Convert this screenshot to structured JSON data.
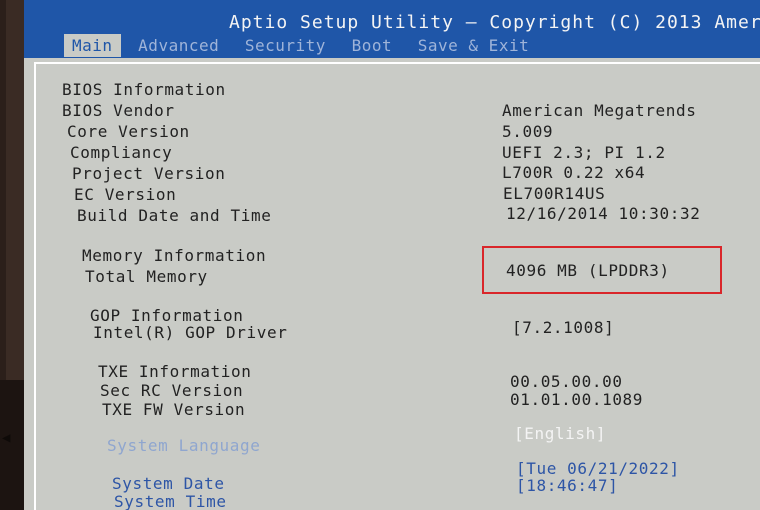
{
  "header": {
    "title": "Aptio Setup Utility – Copyright (C) 2013 Amer",
    "tabs": [
      "Main",
      "Advanced",
      "Security",
      "Boot",
      "Save & Exit"
    ],
    "active_tab": "Main"
  },
  "bios_info": {
    "section_label": "BIOS Information",
    "rows": [
      {
        "label": "BIOS Vendor",
        "value": "American Megatrends"
      },
      {
        "label": "Core Version",
        "value": "5.009"
      },
      {
        "label": "Compliancy",
        "value": "UEFI 2.3; PI 1.2"
      },
      {
        "label": "Project Version",
        "value": "L700R 0.22 x64"
      },
      {
        "label": "EC Version",
        "value": "EL700R14US"
      },
      {
        "label": "Build Date and Time",
        "value": "12/16/2014 10:30:32"
      }
    ]
  },
  "memory_info": {
    "section_label": "Memory Information",
    "total_label": "Total Memory",
    "total_value": "4096 MB (LPDDR3)"
  },
  "gop_info": {
    "section_label": "GOP Information",
    "driver_label": "Intel(R) GOP Driver",
    "driver_value": "[7.2.1008]"
  },
  "txe_info": {
    "section_label": "TXE Information",
    "rows": [
      {
        "label": "Sec RC Version",
        "value": "00.05.00.00"
      },
      {
        "label": "TXE FW Version",
        "value": "01.01.00.1089"
      }
    ]
  },
  "system": {
    "language_label": "System Language",
    "language_value": "[English]",
    "date_label": "System Date",
    "date_value": "[Tue 06/21/2022]",
    "time_label": "System Time",
    "time_value": "[18:46:47]"
  },
  "colors": {
    "title_bar": "#1f56a8",
    "screen_bg": "#c9cbc6",
    "highlight": "#d9262a",
    "editable_text": "#2d55a6"
  }
}
